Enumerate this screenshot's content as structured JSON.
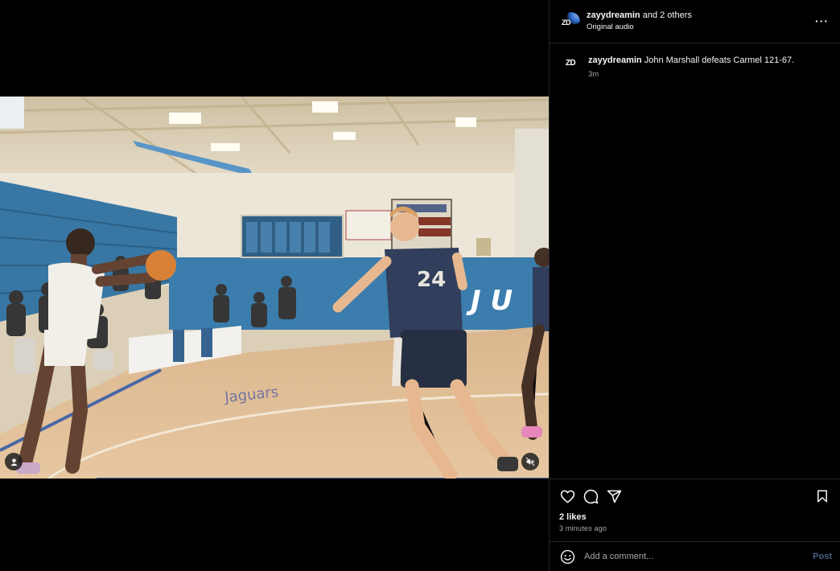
{
  "post": {
    "header": {
      "username": "zayydreamin",
      "collab_suffix": " and 2 others",
      "audio": "Original audio",
      "more_glyph": "···"
    },
    "caption": {
      "username": "zayydreamin",
      "text": " John Marshall defeats Carmel 121-67.",
      "time": "3m"
    },
    "avatar_monogram": "ZD",
    "likes": "2 likes",
    "posted": "3 minutes ago",
    "comment": {
      "placeholder": "Add a comment...",
      "post_label": "Post"
    }
  },
  "icons": {
    "tag": "person-tag-icon",
    "mute": "muted-speaker-icon",
    "like": "heart-icon",
    "comment": "speech-bubble-icon",
    "share": "paper-plane-icon",
    "save": "bookmark-icon",
    "emoji": "smiley-icon",
    "more": "ellipsis-icon"
  },
  "colors": {
    "background": "#000000",
    "divider": "#262626",
    "secondary_text": "#a8a8a8",
    "post_button": "#4a5f86",
    "avatar_accent": "#2f6fd0"
  }
}
